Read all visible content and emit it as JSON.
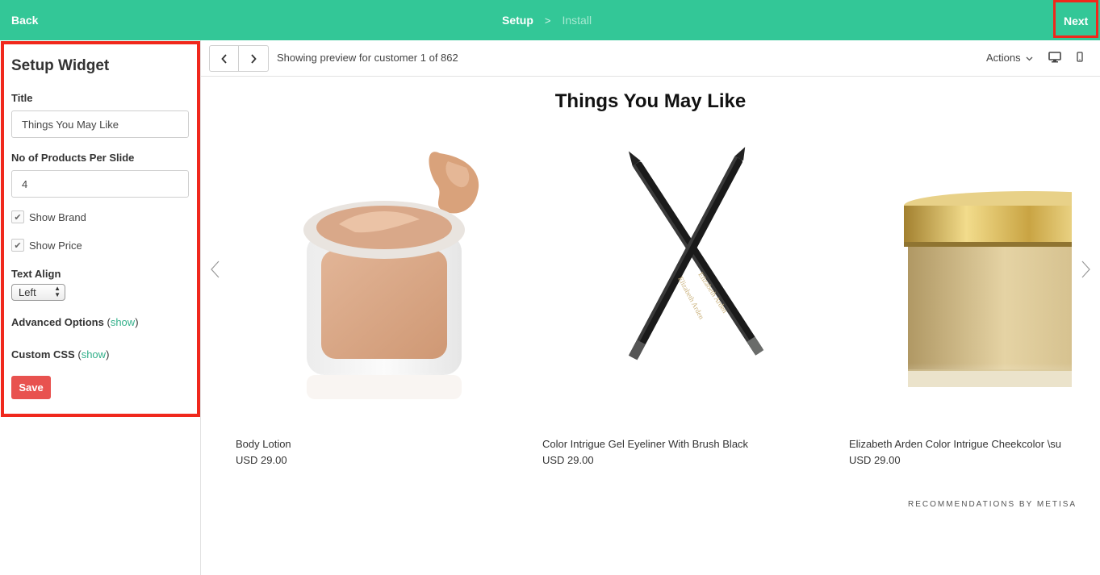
{
  "topbar": {
    "back_label": "Back",
    "steps": [
      "Setup",
      "Install"
    ],
    "chevron": ">",
    "next_label": "Next"
  },
  "sidebar": {
    "heading": "Setup Widget",
    "title_label": "Title",
    "title_value": "Things You May Like",
    "products_label": "No of Products Per Slide",
    "products_value": "4",
    "show_brand_label": "Show Brand",
    "show_brand_checked": true,
    "show_price_label": "Show Price",
    "show_price_checked": true,
    "text_align_label": "Text Align",
    "text_align_value": "Left",
    "advanced_label": "Advanced Options",
    "advanced_link": "show",
    "css_label": "Custom CSS",
    "css_link": "show",
    "save_label": "Save"
  },
  "preview_toolbar": {
    "prev_icon": "chevron-left-icon",
    "next_icon": "chevron-right-icon",
    "preview_text": "Showing preview for customer 1 of 862",
    "actions_label": "Actions",
    "desktop_icon": "desktop-icon",
    "mobile_icon": "mobile-icon"
  },
  "widget": {
    "title": "Things You May Like",
    "products": [
      {
        "name": "Body Lotion",
        "price": "USD 29.00"
      },
      {
        "name": "Color Intrigue Gel Eyeliner With Brush Black",
        "price": "USD 29.00"
      },
      {
        "name": "Elizabeth Arden Color Intrigue Cheekcolor \\su",
        "price": "USD 29.00"
      }
    ],
    "eyeliner_brand_text": "Elizabeth Arden",
    "footer": "RECOMMENDATIONS BY METISA"
  },
  "colors": {
    "brand": "#33c797",
    "highlight": "#f0281c",
    "save": "#e8524f",
    "link": "#33b08a"
  }
}
